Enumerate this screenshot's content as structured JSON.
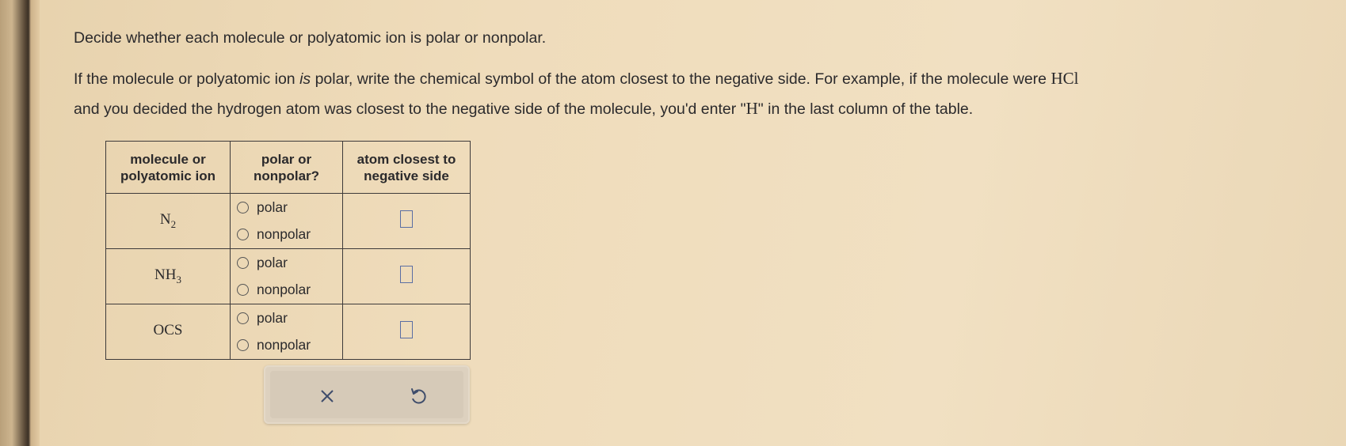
{
  "question": {
    "line1": "Decide whether each molecule or polyatomic ion is polar or nonpolar.",
    "line2_a": "If the molecule or polyatomic ion ",
    "line2_is": "is",
    "line2_b": " polar, write the chemical symbol of the atom closest to the negative side. For example, if the molecule were ",
    "line2_hcl": "HCl",
    "line3_a": "and you decided the hydrogen atom was closest to the negative side of the molecule, you'd enter \"",
    "line3_h": "H",
    "line3_b": "\" in the last column of the table."
  },
  "table": {
    "headers": {
      "col1_line1": "molecule or",
      "col1_line2": "polyatomic ion",
      "col2_line1": "polar or",
      "col2_line2": "nonpolar?",
      "col3_line1": "atom closest to",
      "col3_line2": "negative side"
    },
    "rows": [
      {
        "symbol": "N",
        "subscript": "2",
        "option1": "polar",
        "option2": "nonpolar",
        "answer": ""
      },
      {
        "symbol": "NH",
        "subscript": "3",
        "option1": "polar",
        "option2": "nonpolar",
        "answer": ""
      },
      {
        "symbol": "OCS",
        "subscript": "",
        "option1": "polar",
        "option2": "nonpolar",
        "answer": ""
      }
    ]
  },
  "actions": {
    "clear_icon": "x-icon",
    "undo_icon": "undo-icon"
  }
}
